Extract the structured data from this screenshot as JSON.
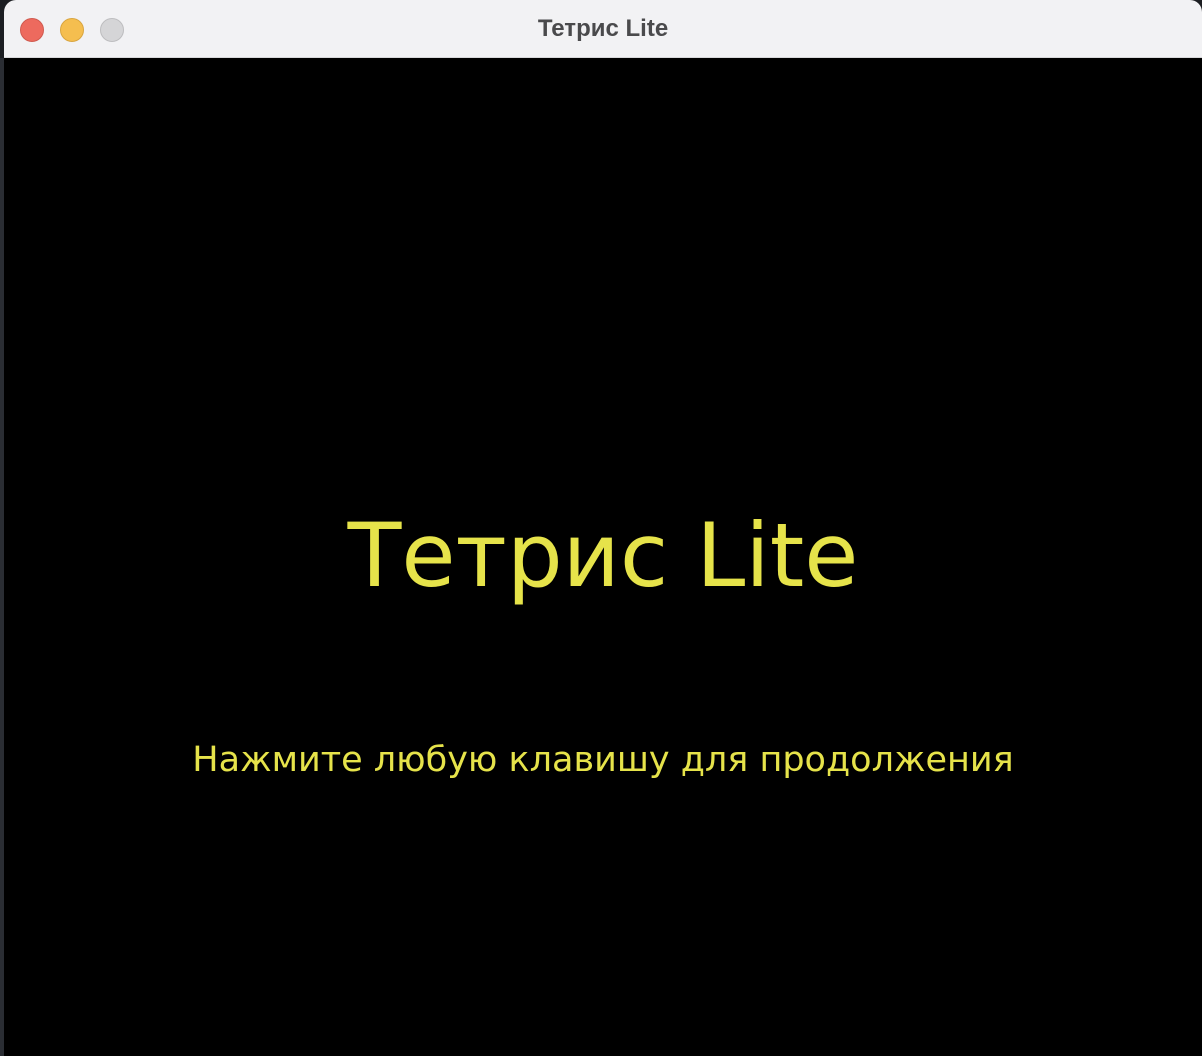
{
  "window": {
    "title": "Тетрис Lite"
  },
  "screen": {
    "title": "Тетрис Lite",
    "prompt": "Нажмите любую клавишу для продолжения"
  },
  "colors": {
    "background": "#000000",
    "text": "#e6e34a",
    "titlebar": "#f2f2f4"
  }
}
